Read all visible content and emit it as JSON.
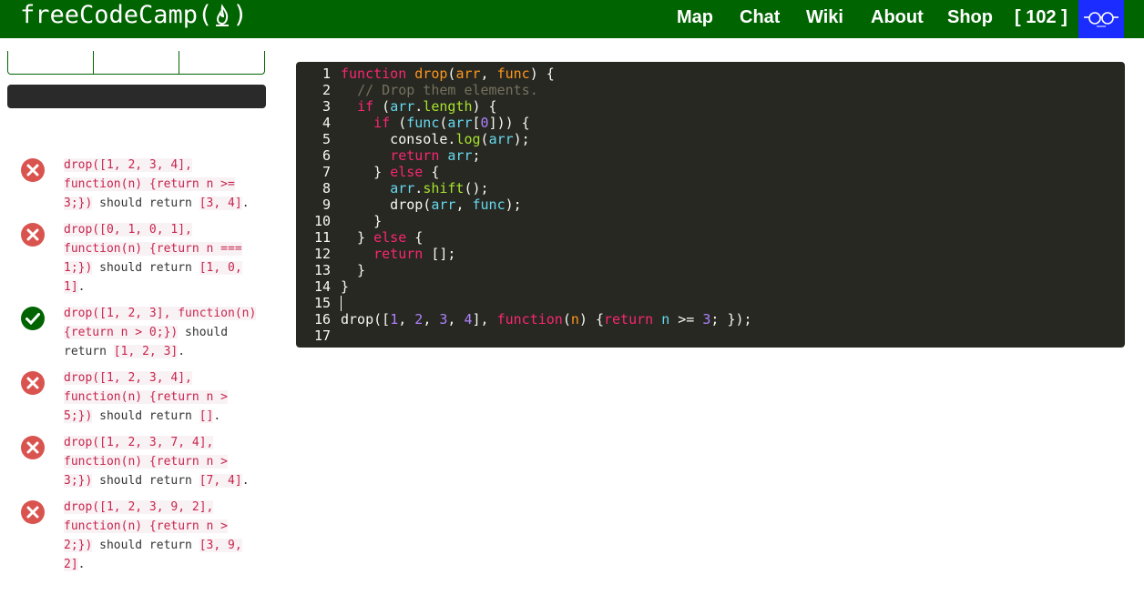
{
  "navbar": {
    "brand_prefix": "freeCodeCamp(",
    "brand_suffix": ")",
    "links": [
      {
        "label": "Map"
      },
      {
        "label": "Chat"
      },
      {
        "label": "Wiki"
      },
      {
        "label": "About"
      },
      {
        "label": "Shop"
      },
      {
        "label": "[ 102 ]"
      }
    ],
    "colors": {
      "background": "#006400",
      "avatar_bg": "#1a2cff"
    }
  },
  "tests": [
    {
      "status": "fail",
      "code1": "drop([1, 2, 3, 4], function(n) {return n >= 3;})",
      "text": " should return ",
      "code2": "[3, 4]",
      "end": "."
    },
    {
      "status": "fail",
      "code1": "drop([0, 1, 0, 1], function(n) {return n === 1;})",
      "text": " should return ",
      "code2": "[1, 0, 1]",
      "end": "."
    },
    {
      "status": "pass",
      "code1": "drop([1, 2, 3], function(n) {return n > 0;})",
      "text": " should return ",
      "code2": "[1, 2, 3]",
      "end": "."
    },
    {
      "status": "fail",
      "code1": "drop([1, 2, 3, 4], function(n) {return n > 5;})",
      "text": " should return ",
      "code2": "[]",
      "end": "."
    },
    {
      "status": "fail",
      "code1": "drop([1, 2, 3, 7, 4], function(n) {return n > 3;})",
      "text": " should return ",
      "code2": "[7, 4]",
      "end": "."
    },
    {
      "status": "fail",
      "code1": "drop([1, 2, 3, 9, 2], function(n) {return n > 2;})",
      "text": " should return ",
      "code2": "[3, 9, 2]",
      "end": "."
    }
  ],
  "status_colors": {
    "fail": "#d9534f",
    "pass": "#006400"
  },
  "editor": {
    "theme_colors": {
      "background": "#272822",
      "keyword": "#f92672",
      "function": "#fd971f",
      "property": "#a6e22e",
      "variable": "#66d9ef",
      "number": "#ae81ff",
      "comment": "#75715e"
    },
    "lines": [
      [
        [
          "kw",
          "function"
        ],
        [
          "pl",
          " "
        ],
        [
          "def",
          "drop"
        ],
        [
          "pl",
          "("
        ],
        [
          "def",
          "arr"
        ],
        [
          "pl",
          ", "
        ],
        [
          "def",
          "func"
        ],
        [
          "pl",
          ") {"
        ]
      ],
      [
        [
          "pl",
          "  "
        ],
        [
          "cmt",
          "// Drop them elements."
        ]
      ],
      [
        [
          "pl",
          "  "
        ],
        [
          "kw",
          "if"
        ],
        [
          "pl",
          " ("
        ],
        [
          "var",
          "arr"
        ],
        [
          "pl",
          "."
        ],
        [
          "prop",
          "length"
        ],
        [
          "pl",
          ") {"
        ]
      ],
      [
        [
          "pl",
          "    "
        ],
        [
          "kw",
          "if"
        ],
        [
          "pl",
          " ("
        ],
        [
          "var",
          "func"
        ],
        [
          "pl",
          "("
        ],
        [
          "var",
          "arr"
        ],
        [
          "pl",
          "["
        ],
        [
          "num",
          "0"
        ],
        [
          "pl",
          "])) {"
        ]
      ],
      [
        [
          "pl",
          "      console."
        ],
        [
          "prop",
          "log"
        ],
        [
          "pl",
          "("
        ],
        [
          "var",
          "arr"
        ],
        [
          "pl",
          ");"
        ]
      ],
      [
        [
          "pl",
          "      "
        ],
        [
          "kw",
          "return"
        ],
        [
          "pl",
          " "
        ],
        [
          "var",
          "arr"
        ],
        [
          "pl",
          ";"
        ]
      ],
      [
        [
          "pl",
          "    } "
        ],
        [
          "kw",
          "else"
        ],
        [
          "pl",
          " {"
        ]
      ],
      [
        [
          "pl",
          "      "
        ],
        [
          "var",
          "arr"
        ],
        [
          "pl",
          "."
        ],
        [
          "prop",
          "shift"
        ],
        [
          "pl",
          "();"
        ]
      ],
      [
        [
          "pl",
          "      drop("
        ],
        [
          "var",
          "arr"
        ],
        [
          "pl",
          ", "
        ],
        [
          "var",
          "func"
        ],
        [
          "pl",
          ");"
        ]
      ],
      [
        [
          "pl",
          "    }"
        ]
      ],
      [
        [
          "pl",
          "  } "
        ],
        [
          "kw",
          "else"
        ],
        [
          "pl",
          " {"
        ]
      ],
      [
        [
          "pl",
          "    "
        ],
        [
          "kw",
          "return"
        ],
        [
          "pl",
          " [];"
        ]
      ],
      [
        [
          "pl",
          "  }"
        ]
      ],
      [
        [
          "pl",
          "}"
        ]
      ],
      [],
      [
        [
          "pl",
          "drop(["
        ],
        [
          "num",
          "1"
        ],
        [
          "pl",
          ", "
        ],
        [
          "num",
          "2"
        ],
        [
          "pl",
          ", "
        ],
        [
          "num",
          "3"
        ],
        [
          "pl",
          ", "
        ],
        [
          "num",
          "4"
        ],
        [
          "pl",
          "], "
        ],
        [
          "kw",
          "function"
        ],
        [
          "pl",
          "("
        ],
        [
          "def",
          "n"
        ],
        [
          "pl",
          ") {"
        ],
        [
          "kw",
          "return"
        ],
        [
          "pl",
          " "
        ],
        [
          "var",
          "n"
        ],
        [
          "pl",
          " >= "
        ],
        [
          "num",
          "3"
        ],
        [
          "pl",
          "; });"
        ]
      ],
      []
    ],
    "cursor_line": 15
  }
}
